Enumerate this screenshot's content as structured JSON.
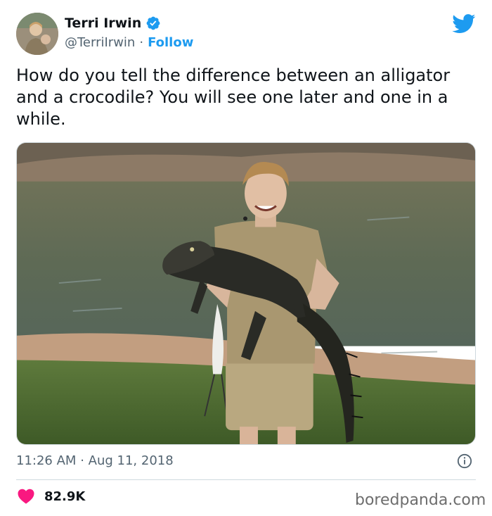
{
  "author": {
    "name": "Terri Irwin",
    "handle": "@TerriIrwin",
    "separator": "·",
    "follow_label": "Follow",
    "avatar_icon": "profile-photo",
    "verified_icon": "verified-badge-icon"
  },
  "brand": {
    "icon": "twitter-bird-icon",
    "color": "#1d9bf0"
  },
  "tweet": {
    "text": "How do you tell the difference between an alligator and a crocodile? You will see one later and one in a while."
  },
  "media": {
    "kind": "photo",
    "subject": "man holding an alligator by a pond"
  },
  "meta": {
    "time": "11:26 AM",
    "separator": "·",
    "date": "Aug 11, 2018",
    "info_icon": "info-icon"
  },
  "engagement": {
    "like_icon": "heart-icon",
    "like_color": "#f91880",
    "likes": "82.9K"
  },
  "watermark": "boredpanda.com"
}
